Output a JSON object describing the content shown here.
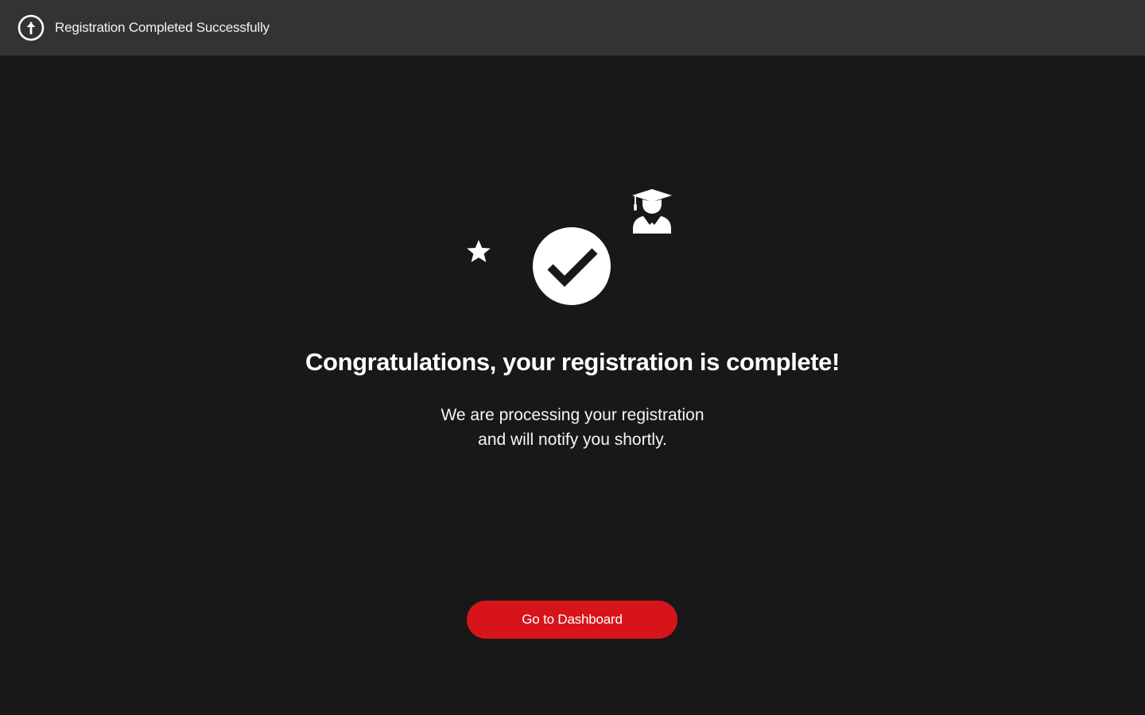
{
  "header": {
    "title": "Registration Completed Successfully",
    "icon": "upload-circle-icon"
  },
  "main": {
    "icons": [
      "star-icon",
      "check-circle-icon",
      "graduate-icon"
    ],
    "headline": "Congratulations, your registration is complete!",
    "message_line_1": "We are processing your registration",
    "message_line_2": "and will notify you shortly.",
    "cta_label": "Go to Dashboard"
  },
  "colors": {
    "background": "#181818",
    "header_background": "#333333",
    "accent": "#d71419",
    "text": "#ffffff"
  }
}
